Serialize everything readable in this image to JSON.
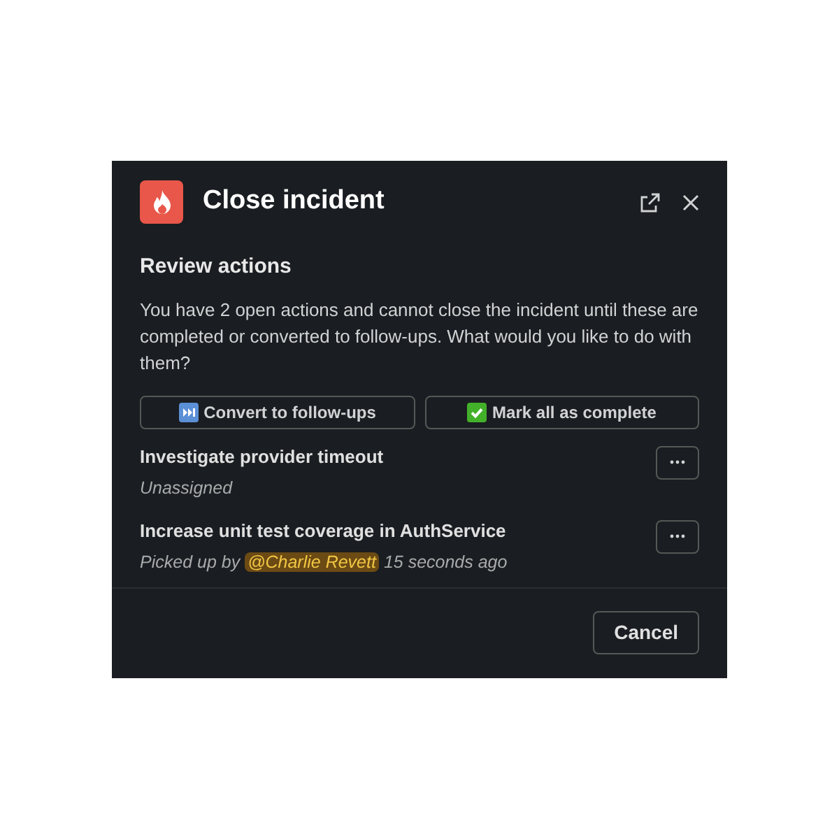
{
  "dialog": {
    "title": "Close incident"
  },
  "section": {
    "heading": "Review actions",
    "description": "You have 2 open actions and cannot close the incident until these are completed or converted to follow-ups. What would you like to do with them?"
  },
  "bulk_buttons": [
    {
      "kind": "convert",
      "label": "Convert to follow-ups"
    },
    {
      "kind": "complete",
      "label": "Mark all as complete"
    }
  ],
  "actions": [
    {
      "title": "Investigate provider timeout",
      "kind": "unassigned",
      "status": "Unassigned"
    },
    {
      "title": "Increase unit test coverage in AuthService",
      "kind": "assigned",
      "prefix": "Picked up by",
      "mention": "@Charlie Revett",
      "suffix": "15 seconds ago"
    }
  ],
  "footer": {
    "cancel": "Cancel"
  }
}
